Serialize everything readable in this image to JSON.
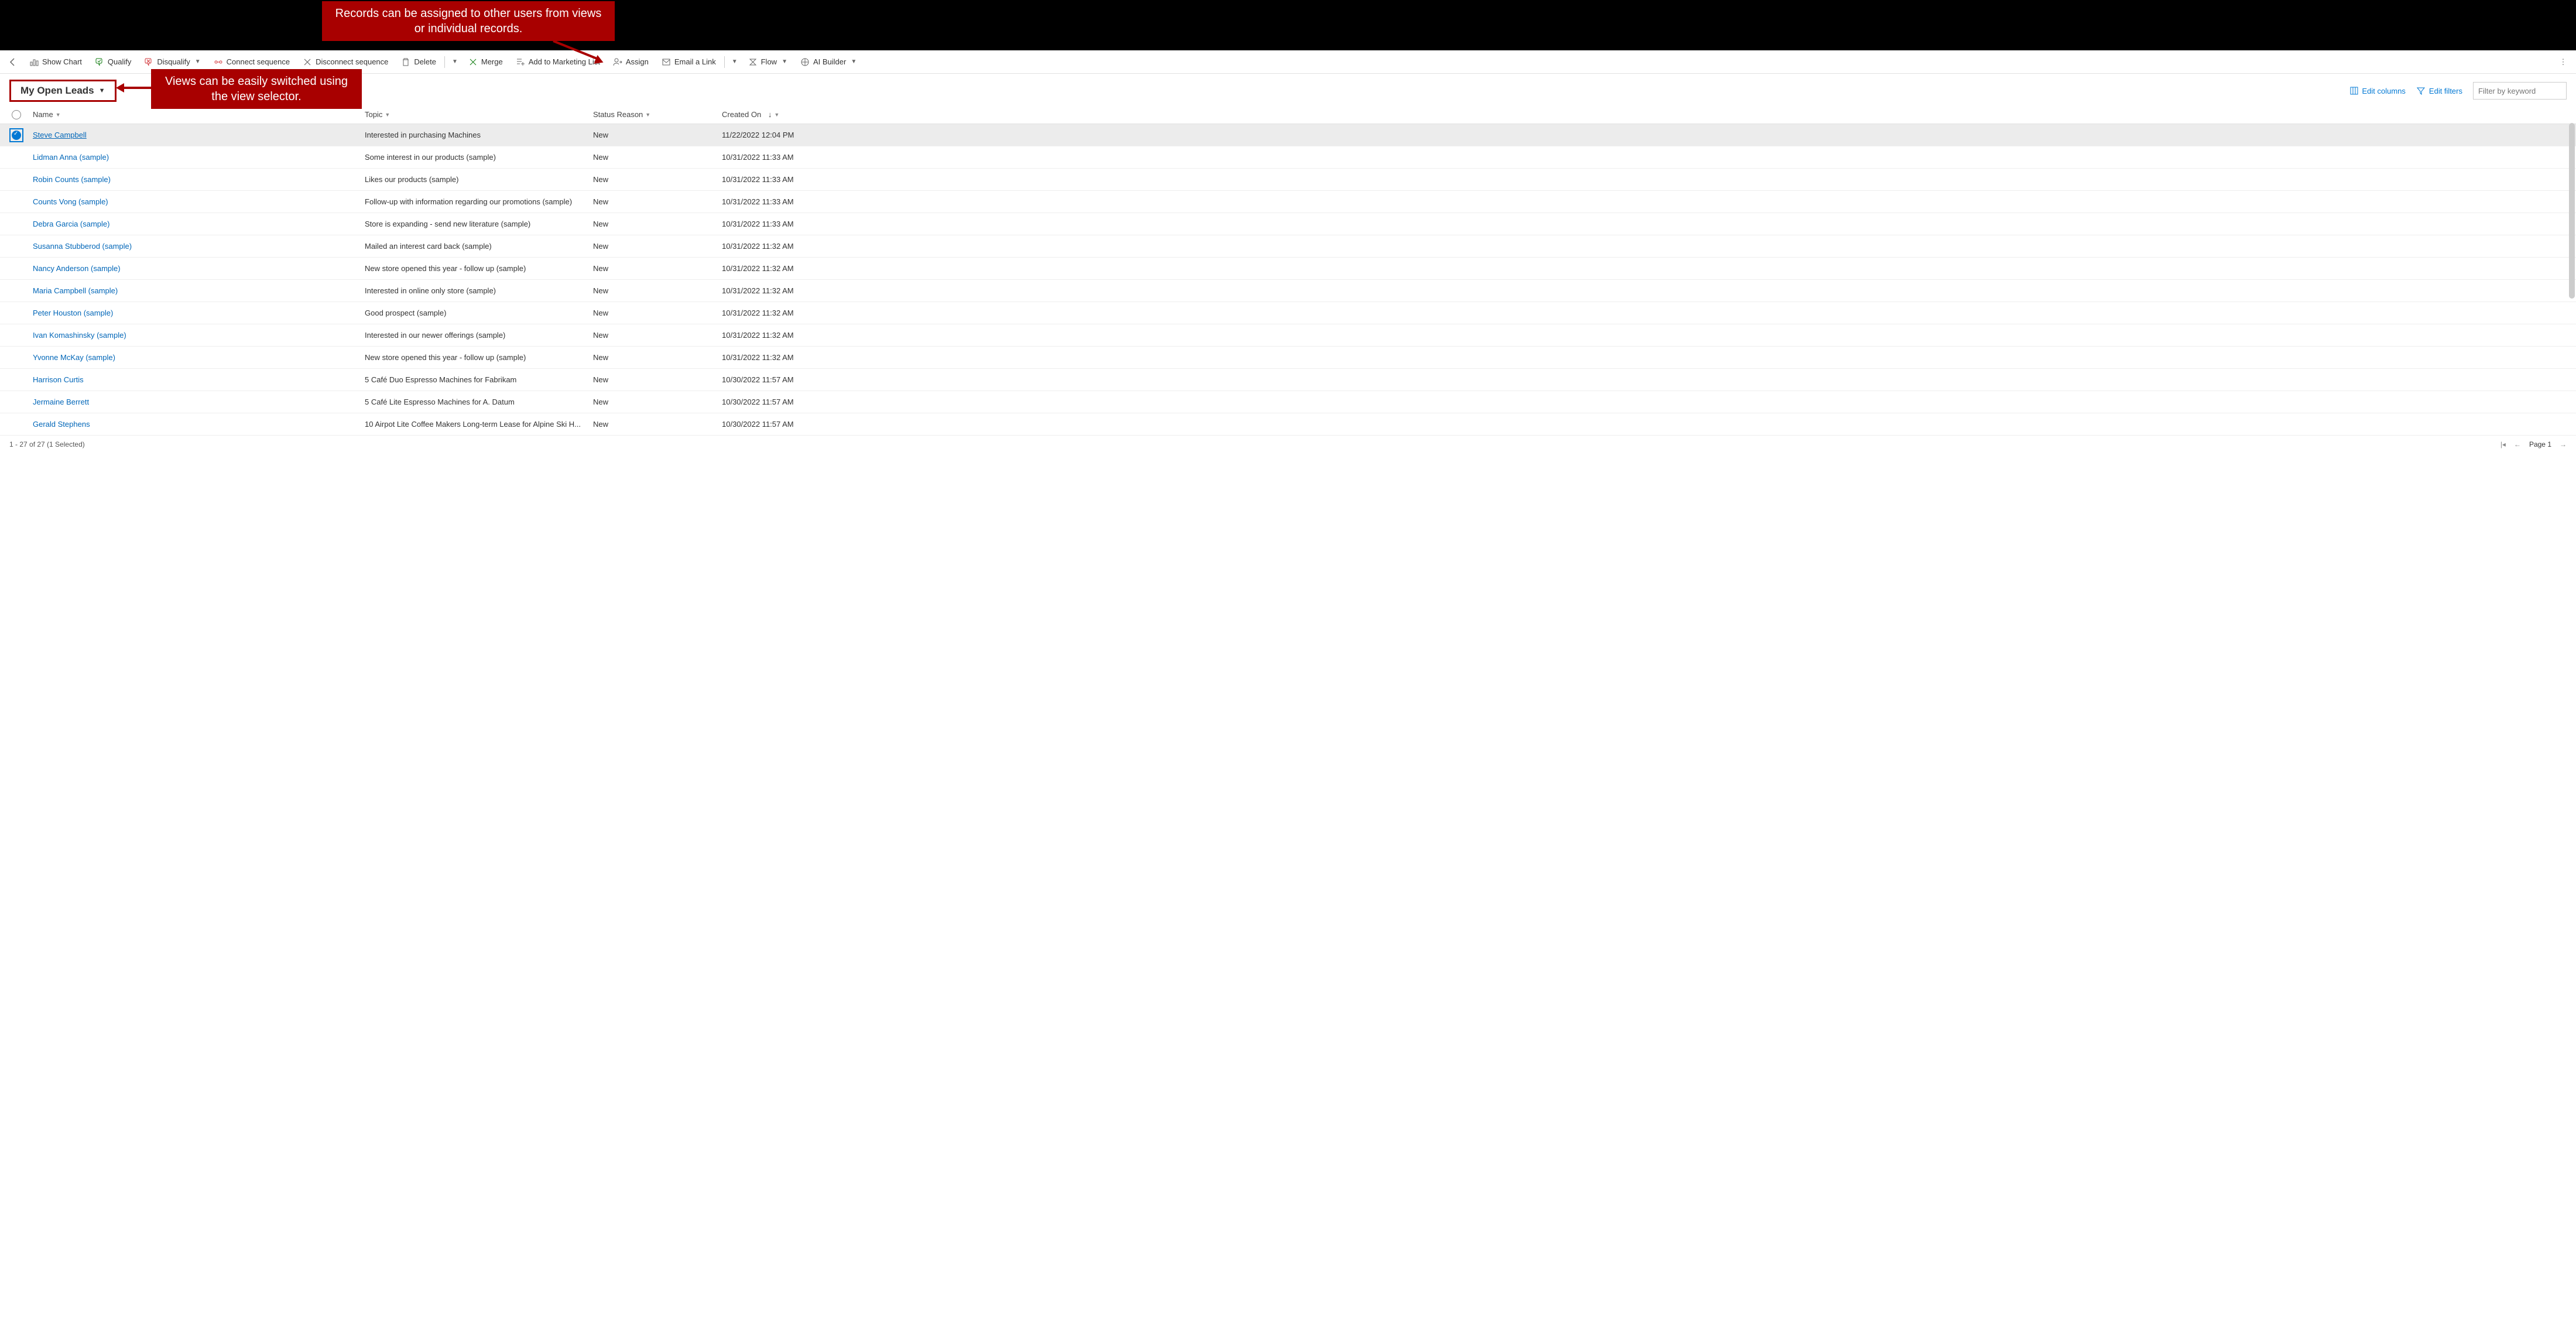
{
  "callouts": {
    "top": "Records can be assigned to other users from views or individual records.",
    "mid": "Views can be easily switched using the  view selector."
  },
  "toolbar": {
    "show_chart": "Show Chart",
    "qualify": "Qualify",
    "disqualify": "Disqualify",
    "connect_seq": "Connect sequence",
    "disconnect_seq": "Disconnect sequence",
    "delete": "Delete",
    "merge": "Merge",
    "add_marketing": "Add to Marketing List",
    "assign": "Assign",
    "email_link": "Email a Link",
    "flow": "Flow",
    "ai_builder": "AI Builder"
  },
  "view": {
    "name": "My Open Leads",
    "edit_columns": "Edit columns",
    "edit_filters": "Edit filters",
    "filter_placeholder": "Filter by keyword"
  },
  "columns": {
    "name": "Name",
    "topic": "Topic",
    "status": "Status Reason",
    "created": "Created On"
  },
  "rows": [
    {
      "selected": true,
      "name": "Steve Campbell",
      "topic": "Interested in purchasing Machines",
      "status": "New",
      "created": "11/22/2022 12:04 PM"
    },
    {
      "selected": false,
      "name": "Lidman Anna (sample)",
      "topic": "Some interest in our products (sample)",
      "status": "New",
      "created": "10/31/2022 11:33 AM"
    },
    {
      "selected": false,
      "name": "Robin Counts (sample)",
      "topic": "Likes our products (sample)",
      "status": "New",
      "created": "10/31/2022 11:33 AM"
    },
    {
      "selected": false,
      "name": "Counts Vong (sample)",
      "topic": "Follow-up with information regarding our promotions (sample)",
      "status": "New",
      "created": "10/31/2022 11:33 AM"
    },
    {
      "selected": false,
      "name": "Debra Garcia (sample)",
      "topic": "Store is expanding - send new literature (sample)",
      "status": "New",
      "created": "10/31/2022 11:33 AM"
    },
    {
      "selected": false,
      "name": "Susanna Stubberod (sample)",
      "topic": "Mailed an interest card back (sample)",
      "status": "New",
      "created": "10/31/2022 11:32 AM"
    },
    {
      "selected": false,
      "name": "Nancy Anderson (sample)",
      "topic": "New store opened this year - follow up (sample)",
      "status": "New",
      "created": "10/31/2022 11:32 AM"
    },
    {
      "selected": false,
      "name": "Maria Campbell (sample)",
      "topic": "Interested in online only store (sample)",
      "status": "New",
      "created": "10/31/2022 11:32 AM"
    },
    {
      "selected": false,
      "name": "Peter Houston (sample)",
      "topic": "Good prospect (sample)",
      "status": "New",
      "created": "10/31/2022 11:32 AM"
    },
    {
      "selected": false,
      "name": "Ivan Komashinsky (sample)",
      "topic": "Interested in our newer offerings (sample)",
      "status": "New",
      "created": "10/31/2022 11:32 AM"
    },
    {
      "selected": false,
      "name": "Yvonne McKay (sample)",
      "topic": "New store opened this year - follow up (sample)",
      "status": "New",
      "created": "10/31/2022 11:32 AM"
    },
    {
      "selected": false,
      "name": "Harrison Curtis",
      "topic": "5 Café Duo Espresso Machines for Fabrikam",
      "status": "New",
      "created": "10/30/2022 11:57 AM"
    },
    {
      "selected": false,
      "name": "Jermaine Berrett",
      "topic": "5 Café Lite Espresso Machines for A. Datum",
      "status": "New",
      "created": "10/30/2022 11:57 AM"
    },
    {
      "selected": false,
      "name": "Gerald Stephens",
      "topic": "10 Airpot Lite Coffee Makers Long-term Lease for Alpine Ski H...",
      "status": "New",
      "created": "10/30/2022 11:57 AM"
    }
  ],
  "footer": {
    "count": "1 - 27 of 27 (1 Selected)",
    "page": "Page 1"
  }
}
